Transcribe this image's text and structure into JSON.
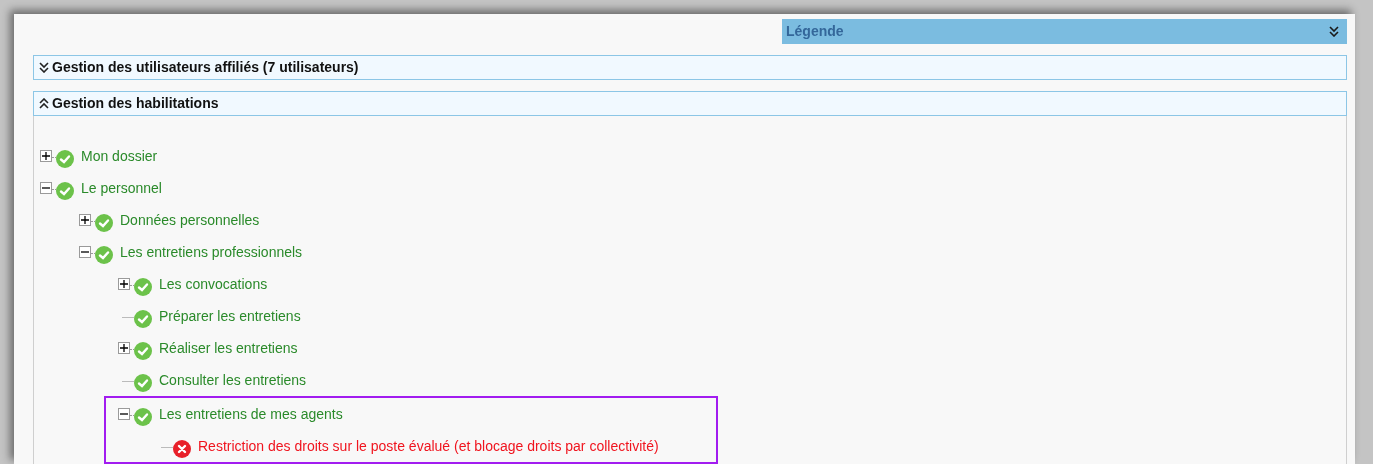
{
  "legend": {
    "title": "Légende",
    "expanded": false
  },
  "sections": [
    {
      "title": "Gestion des utilisateurs affiliés (7 utilisateurs)",
      "expanded": false
    },
    {
      "title": "Gestion des habilitations",
      "expanded": true
    }
  ],
  "tree": [
    {
      "label": "Mon dossier",
      "kind": "granted",
      "expanded": false
    },
    {
      "label": "Le personnel",
      "kind": "granted",
      "expanded": true,
      "children": [
        {
          "label": "Données personnelles",
          "kind": "granted",
          "expanded": false
        },
        {
          "label": "Les entretiens professionnels",
          "kind": "granted",
          "expanded": true,
          "children": [
            {
              "label": "Les convocations",
              "kind": "granted",
              "expanded": false
            },
            {
              "label": "Préparer les entretiens",
              "kind": "granted"
            },
            {
              "label": "Réaliser les entretiens",
              "kind": "granted",
              "expanded": false
            },
            {
              "label": "Consulter les entretiens",
              "kind": "granted"
            },
            {
              "label": "Les entretiens de mes agents",
              "kind": "granted",
              "expanded": true,
              "highlighted": true,
              "children": [
                {
                  "label": "Restriction des droits sur le poste évalué (et blocage droits par collectivité)",
                  "kind": "denied"
                }
              ]
            }
          ]
        }
      ]
    }
  ]
}
